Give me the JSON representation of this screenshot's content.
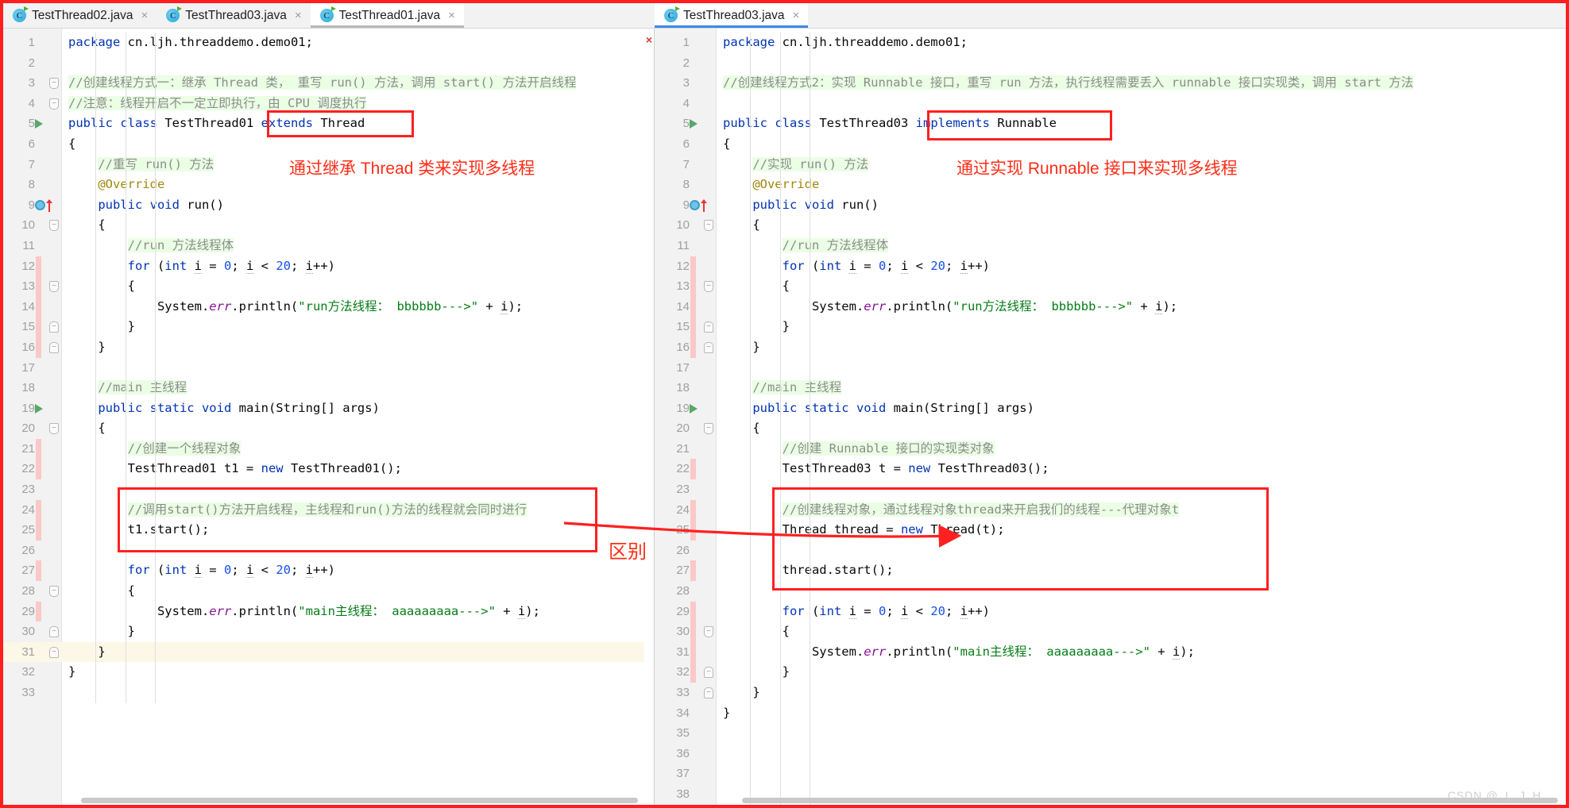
{
  "window": {
    "accent_red": "#ff2020",
    "watermark": "CSDN @_L_J_H_"
  },
  "left_panel": {
    "tabs": [
      {
        "label": "TestThread02.java",
        "active": false,
        "icon": "java-class-icon",
        "close": "×"
      },
      {
        "label": "TestThread03.java",
        "active": false,
        "icon": "java-class-icon",
        "close": "×"
      },
      {
        "label": "TestThread01.java",
        "active": true,
        "icon": "java-class-icon",
        "close": "×"
      }
    ],
    "annotations": {
      "class_box_text": "extends Thread",
      "note": "通过继承 Thread 类来实现多线程",
      "diff_label": "区别"
    },
    "lines": [
      {
        "n": 1,
        "indent": 0,
        "tokens": [
          [
            "kw",
            "package"
          ],
          [
            "pln",
            " cn.ljh.threaddemo.demo01;"
          ]
        ]
      },
      {
        "n": 2,
        "indent": 0,
        "tokens": []
      },
      {
        "n": 3,
        "indent": 0,
        "fold": "minus",
        "tokens": [
          [
            "cm",
            "//创建线程方式一：继承 Thread 类， 重写 run() 方法，调用 start() 方法开启线程"
          ]
        ]
      },
      {
        "n": 4,
        "indent": 0,
        "fold": "minus",
        "tokens": [
          [
            "cm",
            "//注意：线程开启不一定立即执行，由 CPU 调度执行"
          ]
        ]
      },
      {
        "n": 5,
        "indent": 0,
        "run": true,
        "tokens": [
          [
            "kw",
            "public class "
          ],
          [
            "pln",
            "TestThread01 "
          ],
          [
            "kw",
            "extends "
          ],
          [
            "pln",
            "Thread"
          ]
        ]
      },
      {
        "n": 6,
        "indent": 0,
        "tokens": [
          [
            "pln",
            "{"
          ]
        ]
      },
      {
        "n": 7,
        "indent": 1,
        "tokens": [
          [
            "cm",
            "//重写 run() 方法"
          ]
        ]
      },
      {
        "n": 8,
        "indent": 1,
        "tokens": [
          [
            "ann",
            "@Override"
          ]
        ]
      },
      {
        "n": 9,
        "indent": 1,
        "override": true,
        "tokens": [
          [
            "kw",
            "public void "
          ],
          [
            "pln",
            "run()"
          ]
        ]
      },
      {
        "n": 10,
        "indent": 1,
        "fold": "minus",
        "tokens": [
          [
            "pln",
            "{"
          ]
        ]
      },
      {
        "n": 11,
        "indent": 2,
        "tokens": [
          [
            "cm",
            "//run 方法线程体"
          ]
        ]
      },
      {
        "n": 12,
        "indent": 2,
        "mod": true,
        "tokens": [
          [
            "kw",
            "for "
          ],
          [
            "pln",
            "("
          ],
          [
            "kw",
            "int "
          ],
          [
            "lvar",
            "i"
          ],
          [
            "pln",
            " = "
          ],
          [
            "num2",
            "0"
          ],
          [
            "pln",
            "; "
          ],
          [
            "lvar",
            "i"
          ],
          [
            "pln",
            " < "
          ],
          [
            "num2",
            "20"
          ],
          [
            "pln",
            "; "
          ],
          [
            "lvar",
            "i"
          ],
          [
            "pln",
            "++)"
          ]
        ]
      },
      {
        "n": 13,
        "indent": 2,
        "mod": true,
        "fold": "minus",
        "tokens": [
          [
            "pln",
            "{"
          ]
        ]
      },
      {
        "n": 14,
        "indent": 3,
        "mod": true,
        "tokens": [
          [
            "pln",
            "System."
          ],
          [
            "fld",
            "err"
          ],
          [
            "pln",
            ".println("
          ],
          [
            "str",
            "\"run方法线程： bbbbbb--->\""
          ],
          [
            "pln",
            " + "
          ],
          [
            "lvar",
            "i"
          ],
          [
            "pln",
            ");"
          ]
        ]
      },
      {
        "n": 15,
        "indent": 2,
        "mod": true,
        "fold": "plus",
        "tokens": [
          [
            "pln",
            "}"
          ]
        ]
      },
      {
        "n": 16,
        "indent": 1,
        "mod": true,
        "fold": "plus",
        "tokens": [
          [
            "pln",
            "}"
          ]
        ]
      },
      {
        "n": 17,
        "indent": 1,
        "tokens": []
      },
      {
        "n": 18,
        "indent": 1,
        "tokens": [
          [
            "cm",
            "//main 主线程"
          ]
        ]
      },
      {
        "n": 19,
        "indent": 1,
        "run": true,
        "tokens": [
          [
            "kw",
            "public static void "
          ],
          [
            "pln",
            "main(String[] args)"
          ]
        ]
      },
      {
        "n": 20,
        "indent": 1,
        "fold": "minus",
        "tokens": [
          [
            "pln",
            "{"
          ]
        ]
      },
      {
        "n": 21,
        "indent": 2,
        "mod": true,
        "tokens": [
          [
            "cm",
            "//创建一个线程对象"
          ]
        ]
      },
      {
        "n": 22,
        "indent": 2,
        "mod": true,
        "tokens": [
          [
            "pln",
            "TestThread01 t1 = "
          ],
          [
            "kw",
            "new "
          ],
          [
            "pln",
            "TestThread01();"
          ]
        ]
      },
      {
        "n": 23,
        "indent": 2,
        "tokens": []
      },
      {
        "n": 24,
        "indent": 2,
        "mod": true,
        "tokens": [
          [
            "cm",
            "//调用start()方法开启线程，主线程和run()方法的线程就会同时进行"
          ]
        ]
      },
      {
        "n": 25,
        "indent": 2,
        "mod": true,
        "tokens": [
          [
            "pln",
            "t1.start();"
          ]
        ]
      },
      {
        "n": 26,
        "indent": 2,
        "tokens": []
      },
      {
        "n": 27,
        "indent": 2,
        "mod": true,
        "tokens": [
          [
            "kw",
            "for "
          ],
          [
            "pln",
            "("
          ],
          [
            "kw",
            "int "
          ],
          [
            "lvar",
            "i"
          ],
          [
            "pln",
            " = "
          ],
          [
            "num2",
            "0"
          ],
          [
            "pln",
            "; "
          ],
          [
            "lvar",
            "i"
          ],
          [
            "pln",
            " < "
          ],
          [
            "num2",
            "20"
          ],
          [
            "pln",
            "; "
          ],
          [
            "lvar",
            "i"
          ],
          [
            "pln",
            "++)"
          ]
        ]
      },
      {
        "n": 28,
        "indent": 2,
        "fold": "minus",
        "tokens": [
          [
            "pln",
            "{"
          ]
        ]
      },
      {
        "n": 29,
        "indent": 3,
        "mod": true,
        "tokens": [
          [
            "pln",
            "System."
          ],
          [
            "fld",
            "err"
          ],
          [
            "pln",
            ".println("
          ],
          [
            "str",
            "\"main主线程： aaaaaaaaa--->\""
          ],
          [
            "pln",
            " + "
          ],
          [
            "lvar",
            "i"
          ],
          [
            "pln",
            ");"
          ]
        ]
      },
      {
        "n": 30,
        "indent": 2,
        "fold": "plus",
        "tokens": [
          [
            "pln",
            "}"
          ]
        ]
      },
      {
        "n": 31,
        "indent": 1,
        "cur": true,
        "fold": "plus",
        "tokens": [
          [
            "pln",
            "}"
          ]
        ]
      },
      {
        "n": 32,
        "indent": 0,
        "tokens": [
          [
            "pln",
            "}"
          ]
        ]
      },
      {
        "n": 33,
        "indent": 0,
        "tokens": []
      }
    ]
  },
  "right_panel": {
    "tabs": [
      {
        "label": "TestThread03.java",
        "active": true,
        "icon": "java-class-icon",
        "close": "×"
      }
    ],
    "annotations": {
      "class_box_text": "implements Runnable",
      "note": "通过实现 Runnable 接口来实现多线程"
    },
    "lines": [
      {
        "n": 1,
        "indent": 0,
        "ok": true,
        "tokens": [
          [
            "kw",
            "package"
          ],
          [
            "pln",
            " cn.ljh.threaddemo.demo01;"
          ]
        ]
      },
      {
        "n": 2,
        "indent": 0,
        "tokens": []
      },
      {
        "n": 3,
        "indent": 0,
        "tokens": [
          [
            "cm",
            "//创建线程方式2：实现 Runnable 接口，重写 run 方法，执行线程需要丢入 runnable 接口实现类，调用 start 方法"
          ]
        ]
      },
      {
        "n": 4,
        "indent": 0,
        "tokens": []
      },
      {
        "n": 5,
        "indent": 0,
        "run": true,
        "tokens": [
          [
            "kw",
            "public class "
          ],
          [
            "pln",
            "TestThread03 "
          ],
          [
            "kw",
            "implements "
          ],
          [
            "pln",
            "Runnable"
          ]
        ]
      },
      {
        "n": 6,
        "indent": 0,
        "tokens": [
          [
            "pln",
            "{"
          ]
        ]
      },
      {
        "n": 7,
        "indent": 1,
        "tokens": [
          [
            "cm",
            "//实现 run() 方法"
          ]
        ]
      },
      {
        "n": 8,
        "indent": 1,
        "tokens": [
          [
            "ann",
            "@Override"
          ]
        ]
      },
      {
        "n": 9,
        "indent": 1,
        "override": true,
        "tokens": [
          [
            "kw",
            "public void "
          ],
          [
            "pln",
            "run()"
          ]
        ]
      },
      {
        "n": 10,
        "indent": 1,
        "fold": "minus",
        "tokens": [
          [
            "pln",
            "{"
          ]
        ]
      },
      {
        "n": 11,
        "indent": 2,
        "tokens": [
          [
            "cm",
            "//run 方法线程体"
          ]
        ]
      },
      {
        "n": 12,
        "indent": 2,
        "mod": true,
        "tokens": [
          [
            "kw",
            "for "
          ],
          [
            "pln",
            "("
          ],
          [
            "kw",
            "int "
          ],
          [
            "lvar",
            "i"
          ],
          [
            "pln",
            " = "
          ],
          [
            "num2",
            "0"
          ],
          [
            "pln",
            "; "
          ],
          [
            "lvar",
            "i"
          ],
          [
            "pln",
            " < "
          ],
          [
            "num2",
            "20"
          ],
          [
            "pln",
            "; "
          ],
          [
            "lvar",
            "i"
          ],
          [
            "pln",
            "++)"
          ]
        ]
      },
      {
        "n": 13,
        "indent": 2,
        "mod": true,
        "fold": "minus",
        "tokens": [
          [
            "pln",
            "{"
          ]
        ]
      },
      {
        "n": 14,
        "indent": 3,
        "mod": true,
        "tokens": [
          [
            "pln",
            "System."
          ],
          [
            "fld",
            "err"
          ],
          [
            "pln",
            ".println("
          ],
          [
            "str",
            "\"run方法线程： bbbbbb--->\""
          ],
          [
            "pln",
            " + "
          ],
          [
            "lvar",
            "i"
          ],
          [
            "pln",
            ");"
          ]
        ]
      },
      {
        "n": 15,
        "indent": 2,
        "mod": true,
        "fold": "plus",
        "tokens": [
          [
            "pln",
            "}"
          ]
        ]
      },
      {
        "n": 16,
        "indent": 1,
        "mod": true,
        "fold": "plus",
        "tokens": [
          [
            "pln",
            "}"
          ]
        ]
      },
      {
        "n": 17,
        "indent": 1,
        "tokens": []
      },
      {
        "n": 18,
        "indent": 1,
        "tokens": [
          [
            "cm",
            "//main 主线程"
          ]
        ]
      },
      {
        "n": 19,
        "indent": 1,
        "run": true,
        "tokens": [
          [
            "kw",
            "public static void "
          ],
          [
            "pln",
            "main(String[] args)"
          ]
        ]
      },
      {
        "n": 20,
        "indent": 1,
        "fold": "minus",
        "tokens": [
          [
            "pln",
            "{"
          ]
        ]
      },
      {
        "n": 21,
        "indent": 2,
        "tokens": [
          [
            "cm",
            "//创建 Runnable 接口的实现类对象"
          ]
        ]
      },
      {
        "n": 22,
        "indent": 2,
        "mod": true,
        "tokens": [
          [
            "pln",
            "TestThread03 t = "
          ],
          [
            "kw",
            "new "
          ],
          [
            "pln",
            "TestThread03();"
          ]
        ]
      },
      {
        "n": 23,
        "indent": 2,
        "tokens": []
      },
      {
        "n": 24,
        "indent": 2,
        "mod": true,
        "tokens": [
          [
            "cm",
            "//创建线程对象，通过线程对象thread来开启我们的线程---代理对象t"
          ]
        ]
      },
      {
        "n": 25,
        "indent": 2,
        "mod": true,
        "tokens": [
          [
            "pln",
            "Thread thread = "
          ],
          [
            "kw",
            "new "
          ],
          [
            "pln",
            "Thread(t);"
          ]
        ]
      },
      {
        "n": 26,
        "indent": 2,
        "tokens": []
      },
      {
        "n": 27,
        "indent": 2,
        "mod": true,
        "tokens": [
          [
            "pln",
            "thread.start();"
          ]
        ]
      },
      {
        "n": 28,
        "indent": 2,
        "tokens": []
      },
      {
        "n": 29,
        "indent": 2,
        "mod": true,
        "tokens": [
          [
            "kw",
            "for "
          ],
          [
            "pln",
            "("
          ],
          [
            "kw",
            "int "
          ],
          [
            "lvar",
            "i"
          ],
          [
            "pln",
            " = "
          ],
          [
            "num2",
            "0"
          ],
          [
            "pln",
            "; "
          ],
          [
            "lvar",
            "i"
          ],
          [
            "pln",
            " < "
          ],
          [
            "num2",
            "20"
          ],
          [
            "pln",
            "; "
          ],
          [
            "lvar",
            "i"
          ],
          [
            "pln",
            "++)"
          ]
        ]
      },
      {
        "n": 30,
        "indent": 2,
        "mod": true,
        "fold": "minus",
        "tokens": [
          [
            "pln",
            "{"
          ]
        ]
      },
      {
        "n": 31,
        "indent": 3,
        "mod": true,
        "tokens": [
          [
            "pln",
            "System."
          ],
          [
            "fld",
            "err"
          ],
          [
            "pln",
            ".println("
          ],
          [
            "str",
            "\"main主线程： aaaaaaaaa--->\""
          ],
          [
            "pln",
            " + "
          ],
          [
            "lvar",
            "i"
          ],
          [
            "pln",
            ");"
          ]
        ]
      },
      {
        "n": 32,
        "indent": 2,
        "mod": true,
        "fold": "plus",
        "tokens": [
          [
            "pln",
            "}"
          ]
        ]
      },
      {
        "n": 33,
        "indent": 1,
        "fold": "plus",
        "tokens": [
          [
            "pln",
            "}"
          ]
        ]
      },
      {
        "n": 34,
        "indent": 0,
        "tokens": [
          [
            "pln",
            "}"
          ]
        ]
      },
      {
        "n": 35,
        "indent": 0,
        "tokens": []
      },
      {
        "n": 36,
        "indent": 0,
        "tokens": []
      },
      {
        "n": 37,
        "indent": 0,
        "tokens": []
      },
      {
        "n": 38,
        "indent": 0,
        "tokens": []
      }
    ]
  }
}
